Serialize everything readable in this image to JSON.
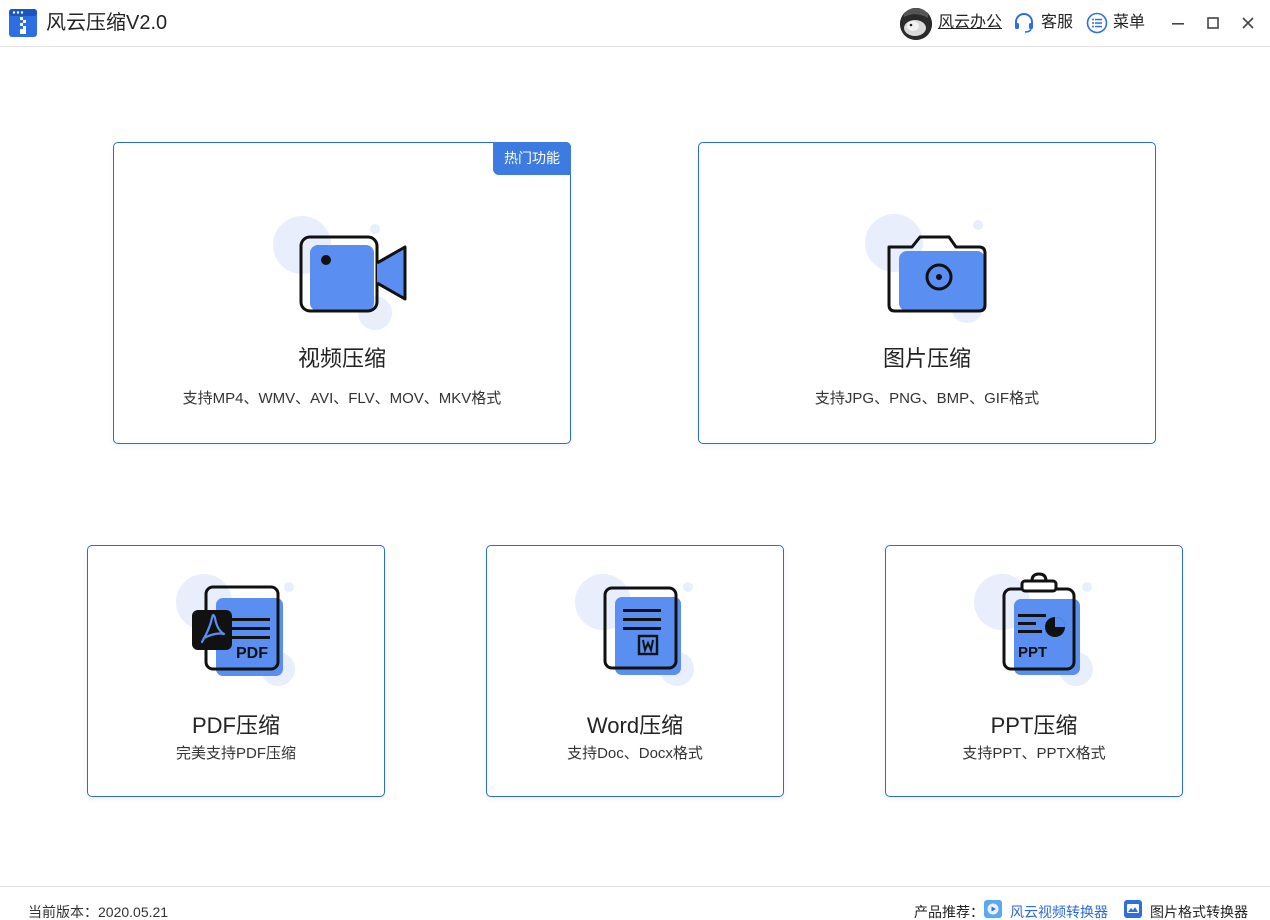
{
  "window": {
    "title": "风云压缩V2.0",
    "user_name": "风云办公",
    "service_label": "客服",
    "menu_label": "菜单"
  },
  "cards": {
    "video": {
      "badge": "热门功能",
      "title": "视频压缩",
      "desc": "支持MP4、WMV、AVI、FLV、MOV、MKV格式"
    },
    "image": {
      "title": "图片压缩",
      "desc": "支持JPG、PNG、BMP、GIF格式"
    },
    "pdf": {
      "title": "PDF压缩",
      "desc": "完美支持PDF压缩",
      "icon_text": "PDF"
    },
    "word": {
      "title": "Word压缩",
      "desc": "支持Doc、Docx格式"
    },
    "ppt": {
      "title": "PPT压缩",
      "desc": "支持PPT、PPTX格式",
      "icon_text": "PPT"
    }
  },
  "footer": {
    "version": "当前版本：2020.05.21",
    "recommend_label": "产品推荐：",
    "rec1": "风云视频转换器",
    "rec2": "图片格式转换器"
  },
  "colors": {
    "accent": "#3d7be0",
    "icon_fill": "#5a8ef0",
    "icon_bg": "#e8eefc",
    "border": "#2e6ad6"
  },
  "icons": {
    "app": "zip-archive-icon",
    "service": "headset-icon",
    "menu": "list-menu-icon",
    "video": "video-camera-icon",
    "image": "photo-camera-icon",
    "pdf": "pdf-document-icon",
    "word": "word-document-icon",
    "ppt": "ppt-clipboard-icon",
    "rec1": "video-converter-icon",
    "rec2": "image-converter-icon"
  }
}
